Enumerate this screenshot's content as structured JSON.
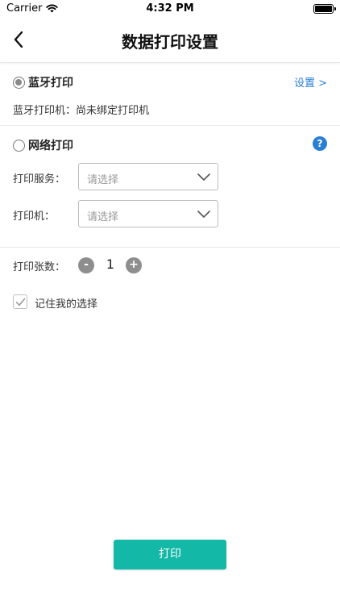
{
  "status_bar": {
    "carrier": "Carrier",
    "time": "4:32 PM"
  },
  "nav": {
    "title": "数据打印设置"
  },
  "bluetooth": {
    "label": "蓝牙打印",
    "selected": true,
    "setting_link": "设置 >",
    "status_text": "蓝牙打印机：尚未绑定打印机"
  },
  "network": {
    "label": "网络打印",
    "selected": false,
    "help_icon": "?",
    "service_label": "打印服务：",
    "service_placeholder": "请选择",
    "printer_label": "打印机：",
    "printer_placeholder": "请选择"
  },
  "copies": {
    "label": "打印张数：",
    "minus": "-",
    "value": "1",
    "plus": "+"
  },
  "remember": {
    "label": "记住我的选择",
    "checked": true
  },
  "actions": {
    "print_label": "打印"
  },
  "colors": {
    "accent": "#14b8a6",
    "link": "#2a7fd4"
  }
}
